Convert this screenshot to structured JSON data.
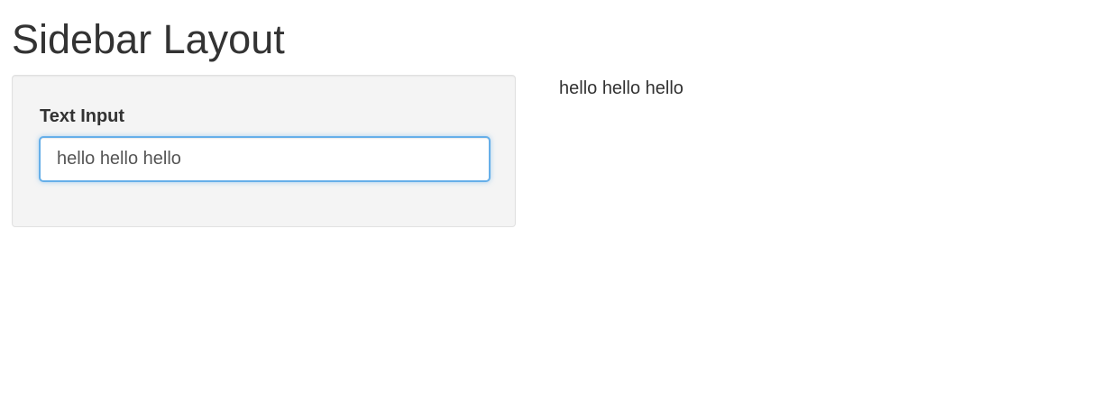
{
  "page": {
    "title": "Sidebar Layout"
  },
  "sidebar": {
    "text_input": {
      "label": "Text Input",
      "value": "hello hello hello"
    }
  },
  "main": {
    "output_text": "hello hello hello"
  },
  "colors": {
    "focus_border": "#66afe9",
    "panel_background": "#f4f4f4",
    "text": "#333333"
  }
}
